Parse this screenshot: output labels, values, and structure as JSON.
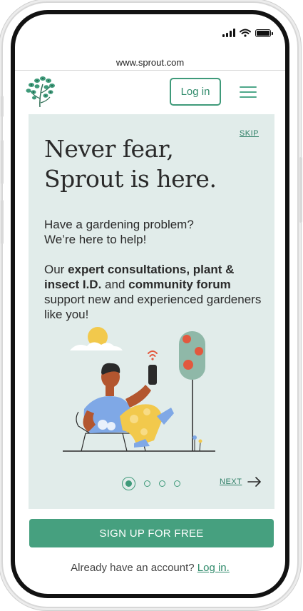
{
  "browser": {
    "url": "www.sprout.com"
  },
  "header": {
    "login_label": "Log in"
  },
  "onboarding": {
    "skip_label": "SKIP",
    "headline_line1": "Never fear,",
    "headline_line2": "Sprout is here.",
    "intro_line1": "Have a gardening problem?",
    "intro_line2": "We’re here to help!",
    "body_prefix": "Our",
    "body_bold1": "expert consultations, plant & insect I.D.",
    "body_and": "and",
    "body_bold2": "community forum",
    "body_suffix": "support new and experienced gardeners like you!",
    "next_label": "NEXT",
    "page_count": 4,
    "current_page": 1
  },
  "cta": {
    "signup_label": "SIGN UP FOR FREE",
    "account_prompt": "Already have an account?",
    "login_link": "Log in."
  },
  "colors": {
    "brand_green": "#46a07f",
    "card_bg": "#e1ecea",
    "text_dark": "#2a2a2a"
  },
  "icons": [
    "signal-icon",
    "wifi-icon",
    "battery-icon",
    "sprout-logo-icon",
    "hamburger-menu-icon",
    "arrow-right-icon"
  ]
}
